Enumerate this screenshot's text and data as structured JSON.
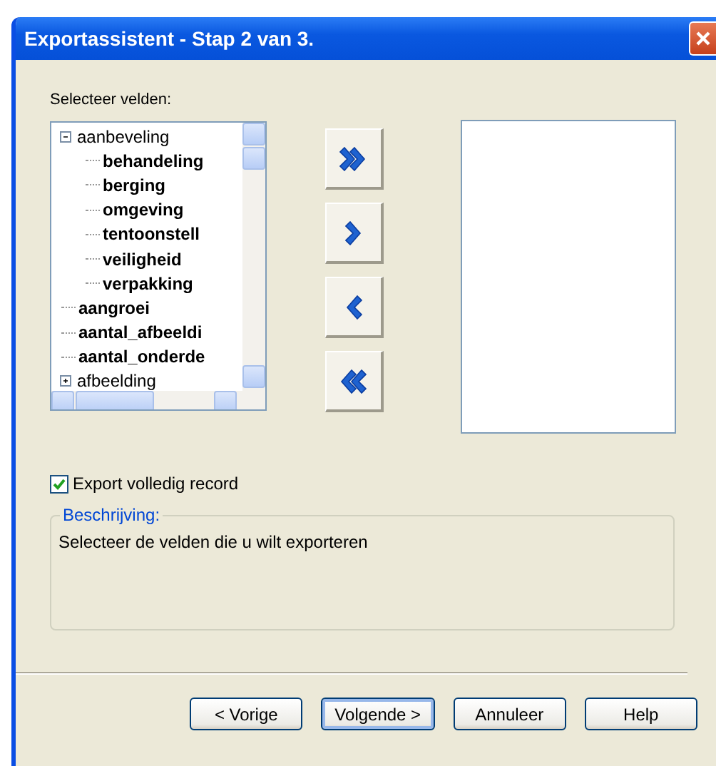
{
  "window": {
    "title": "Exportassistent - Stap 2 van 3."
  },
  "fields_label": "Selecteer velden:",
  "tree": [
    {
      "label": "aanbeveling",
      "kind": "group",
      "expanded": true,
      "children": [
        {
          "label": "behandeling",
          "kind": "field"
        },
        {
          "label": "berging",
          "kind": "field"
        },
        {
          "label": "omgeving",
          "kind": "field"
        },
        {
          "label": "tentoonstell",
          "kind": "field"
        },
        {
          "label": "veiligheid",
          "kind": "field"
        },
        {
          "label": "verpakking",
          "kind": "field"
        }
      ]
    },
    {
      "label": "aangroei",
      "kind": "field"
    },
    {
      "label": "aantal_afbeeldi",
      "kind": "field"
    },
    {
      "label": "aantal_onderde",
      "kind": "field"
    },
    {
      "label": "afbeelding",
      "kind": "group",
      "expanded": false
    }
  ],
  "move_buttons": [
    {
      "kind": "add-all"
    },
    {
      "kind": "add"
    },
    {
      "kind": "remove"
    },
    {
      "kind": "remove-all"
    }
  ],
  "export_full_record": {
    "label": "Export volledig record",
    "checked": true
  },
  "description": {
    "legend": "Beschrijving:",
    "text": "Selecteer de velden die u wilt exporteren"
  },
  "buttons": [
    {
      "label": "< Vorige",
      "default": false
    },
    {
      "label": "Volgende >",
      "default": true
    },
    {
      "label": "Annuleer",
      "default": false
    },
    {
      "label": "Help",
      "default": false
    }
  ]
}
